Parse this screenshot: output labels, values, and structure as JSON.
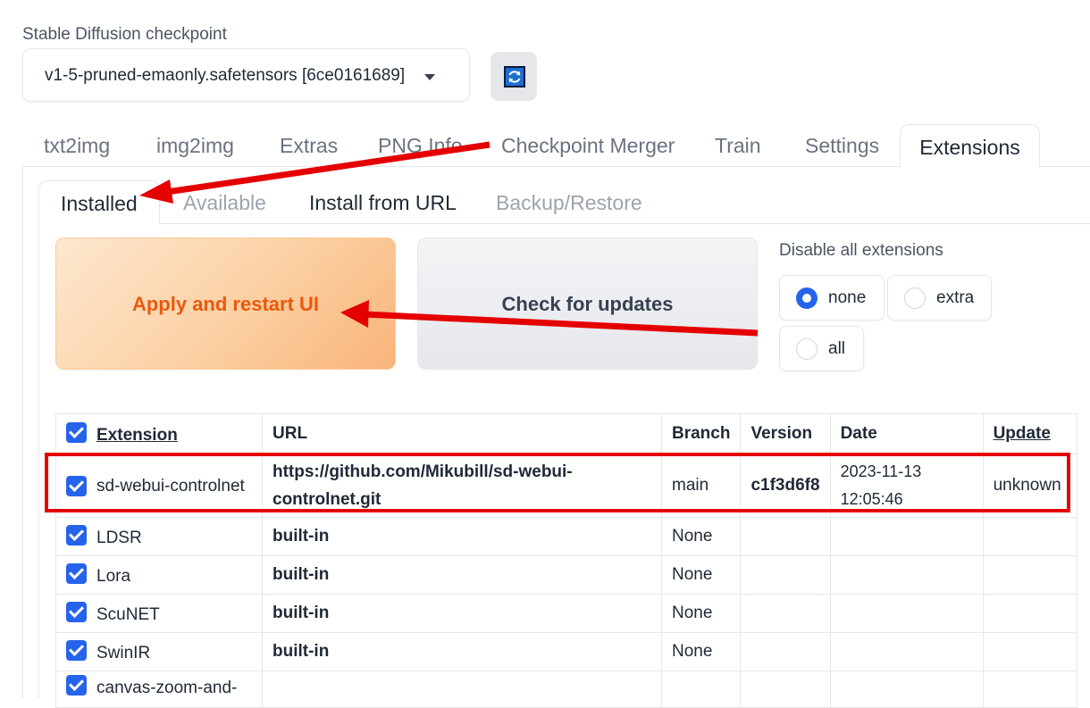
{
  "checkpoint": {
    "label": "Stable Diffusion checkpoint",
    "value": "v1-5-pruned-emaonly.safetensors [6ce0161689]"
  },
  "main_tabs": [
    "txt2img",
    "img2img",
    "Extras",
    "PNG Info",
    "Checkpoint Merger",
    "Train",
    "Settings",
    "Extensions"
  ],
  "sub_tabs": [
    "Installed",
    "Available",
    "Install from URL",
    "Backup/Restore"
  ],
  "buttons": {
    "apply": "Apply and restart UI",
    "check": "Check for updates"
  },
  "disable": {
    "label": "Disable all extensions",
    "options": [
      "none",
      "extra",
      "all"
    ],
    "selected": "none"
  },
  "table": {
    "headers": [
      "Extension",
      "URL",
      "Branch",
      "Version",
      "Date",
      "Update"
    ],
    "rows": [
      {
        "name": "sd-webui-controlnet",
        "url": "https://github.com/Mikubill/sd-webui-controlnet.git",
        "branch": "main",
        "version": "c1f3d6f8",
        "date": "2023-11-13 12:05:46",
        "update": "unknown",
        "checked": true
      },
      {
        "name": "LDSR",
        "url": "built-in",
        "branch": "None",
        "version": "",
        "date": "",
        "update": "",
        "checked": true
      },
      {
        "name": "Lora",
        "url": "built-in",
        "branch": "None",
        "version": "",
        "date": "",
        "update": "",
        "checked": true
      },
      {
        "name": "ScuNET",
        "url": "built-in",
        "branch": "None",
        "version": "",
        "date": "",
        "update": "",
        "checked": true
      },
      {
        "name": "SwinIR",
        "url": "built-in",
        "branch": "None",
        "version": "",
        "date": "",
        "update": "",
        "checked": true
      },
      {
        "name": "canvas-zoom-and-",
        "url": "",
        "branch": "",
        "version": "",
        "date": "",
        "update": "",
        "checked": true
      }
    ]
  },
  "colors": {
    "accent": "#2563eb",
    "apply_text": "#ea580c",
    "annotation": "#e50000"
  }
}
